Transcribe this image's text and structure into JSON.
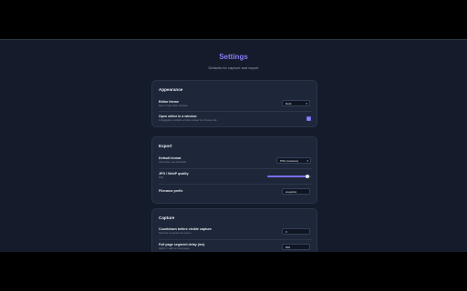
{
  "page": {
    "title": "Settings",
    "subtitle": "Defaults for capture and export"
  },
  "appearance": {
    "title": "Appearance",
    "editor_theme": {
      "label": "Editor theme",
      "hint": "Dark or light editor interface",
      "value": "Dark"
    },
    "open_in_window": {
      "label": "Open editor in a window",
      "hint": "A draggable, resizable window instead of a browser tab",
      "checked": true
    }
  },
  "export": {
    "title": "Export",
    "default_format": {
      "label": "Default format",
      "hint": "Used when you download",
      "value": "PNG (lossless)"
    },
    "quality": {
      "label": "JPG / WebP quality",
      "value_text": "92%",
      "value": 0.92
    },
    "filename_prefix": {
      "label": "Filename prefix",
      "value": "snapshot"
    }
  },
  "capture": {
    "title": "Capture",
    "countdown": {
      "label": "Countdown before visible capture",
      "hint": "Seconds to prepare the screen",
      "value": "0"
    },
    "segment_delay": {
      "label": "Full page segment delay (ms)",
      "hint": "Higher = safer on slow pages",
      "value": "600"
    }
  },
  "colors": {
    "accent": "#7c6cf0",
    "title": "#8b7cf6",
    "background": "#141b2b",
    "card": "#1e2739"
  },
  "icons": {
    "select_chevron": "chevron-down-icon",
    "checkbox_check": "check-icon"
  }
}
